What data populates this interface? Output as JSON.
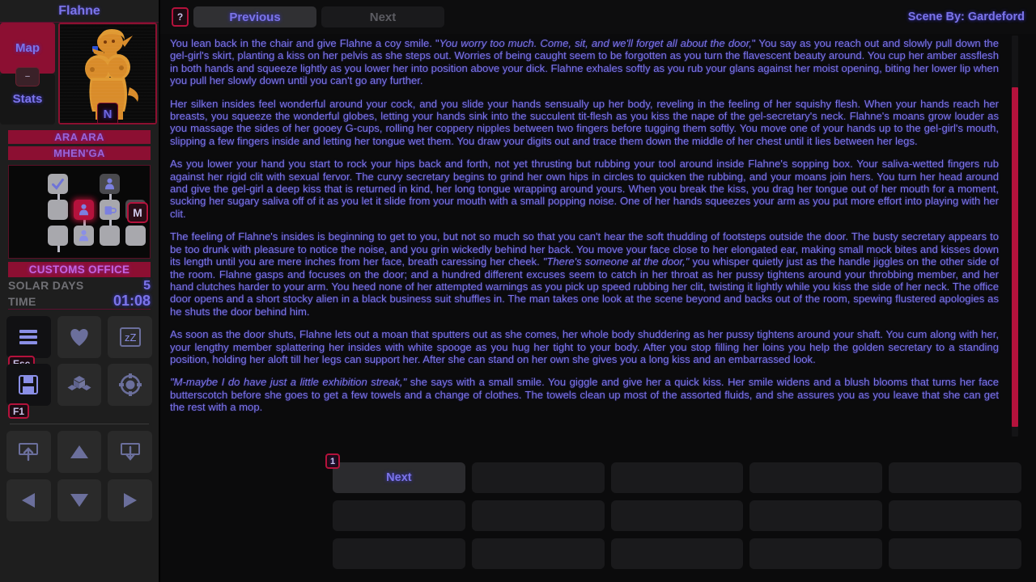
{
  "colors": {
    "accent_crimson": "#b4123c",
    "accent_purple": "#7b74e8",
    "tag_magenta": "#9a63d8",
    "panel_bg": "#1e1e1e",
    "main_bg": "#0b0b0c"
  },
  "sidebar": {
    "character_name": "Flahne",
    "map_button": "Map",
    "stats_button": "Stats",
    "panel_toggle": "–",
    "portrait_badge": "N",
    "tags": [
      "ARA ARA",
      "MHEN'GA"
    ],
    "minimap": {
      "letter_marker": "M",
      "chevron": "⌄"
    },
    "location": "CUSTOMS OFFICE",
    "stats": [
      {
        "label": "SOLAR DAYS",
        "value": "5"
      },
      {
        "label": "TIME",
        "value": "01:08"
      }
    ],
    "icon_buttons": [
      {
        "name": "menu-icon",
        "hotkey": "Esc"
      },
      {
        "name": "heart-icon",
        "hotkey": ""
      },
      {
        "name": "sleep-icon",
        "hotkey": ""
      },
      {
        "name": "save-disk-icon",
        "hotkey": "F1"
      },
      {
        "name": "inventory-cubes-icon",
        "hotkey": ""
      },
      {
        "name": "options-gear-icon",
        "hotkey": ""
      }
    ],
    "nav_buttons": [
      {
        "name": "upload-icon"
      },
      {
        "name": "arrow-up-icon"
      },
      {
        "name": "download-icon"
      },
      {
        "name": "arrow-left-icon"
      },
      {
        "name": "arrow-down-icon"
      },
      {
        "name": "arrow-right-icon"
      }
    ]
  },
  "topbar": {
    "help_label": "?",
    "previous_label": "Previous",
    "next_label": "Next",
    "scene_by": "Scene By: Gardeford"
  },
  "story": {
    "paragraphs": [
      {
        "runs": [
          {
            "t": "You lean back in the chair and give Flahne a coy smile. \"",
            "i": false
          },
          {
            "t": "You worry too much. Come, sit, and we'll forget all about the door,",
            "i": true
          },
          {
            "t": "\" You say as you reach out and slowly pull down the gel-girl's skirt, planting a kiss on her pelvis as she steps out. Worries of being caught seem to be forgotten as you turn the flavescent beauty around. You cup her amber assflesh in both hands and squeeze lightly as you lower her into position above your dick. Flahne exhales softly as you rub your glans against her moist opening, biting her lower lip when you pull her slowly down until you can't go any further.",
            "i": false
          }
        ]
      },
      {
        "runs": [
          {
            "t": "Her silken insides feel wonderful around your cock, and you slide your hands sensually up her body, reveling in the feeling of her squishy flesh. When your hands reach her breasts, you squeeze the wonderful globes, letting your hands sink into the succulent tit-flesh as you kiss the nape of the gel-secretary's neck. Flahne's moans grow louder as you massage the sides of her gooey G-cups, rolling her coppery nipples between two fingers before tugging them softly. You move one of your hands up to the gel-girl's mouth, slipping a few fingers inside and letting her tongue wet them. You draw your digits out and trace them down the middle of her chest until it lies between her legs.",
            "i": false
          }
        ]
      },
      {
        "runs": [
          {
            "t": "As you lower your hand you start to rock your hips back and forth, not yet thrusting but rubbing your tool around inside Flahne's sopping box. Your saliva-wetted fingers rub against her rigid clit with sexual fervor. The curvy secretary begins to grind her own hips in circles to quicken the rubbing, and your moans join hers. You turn her head around and give the gel-girl a deep kiss that is returned in kind, her long tongue wrapping around yours. When you break the kiss, you drag her tongue out of her mouth for a moment, sucking her sugary saliva off of it as you let it slide from your mouth with a small popping noise. One of her hands squeezes your arm as you put more effort into playing with her clit.",
            "i": false
          }
        ]
      },
      {
        "runs": [
          {
            "t": "The feeling of Flahne's insides is beginning to get to you, but not so much so that you can't hear the soft thudding of footsteps outside the door. The busty secretary appears to be too drunk with pleasure to notice the noise, and you grin wickedly behind her back. You move your face close to her elongated ear, making small mock bites and kisses down its length until you are mere inches from her face, breath caressing her cheek. ",
            "i": false
          },
          {
            "t": "\"There's someone at the door,\"",
            "i": true
          },
          {
            "t": " you whisper quietly just as the handle jiggles on the other side of the room. Flahne gasps and focuses on the door; and a hundred different excuses seem to catch in her throat as her pussy tightens around your throbbing member, and her hand clutches harder to your arm. You heed none of her attempted warnings as you pick up speed rubbing her clit, twisting it lightly while you kiss the side of her neck. The office door opens and a short stocky alien in a black business suit shuffles in. The man takes one look at the scene beyond and backs out of the room, spewing flustered apologies as he shuts the door behind him.",
            "i": false
          }
        ]
      },
      {
        "runs": [
          {
            "t": "As soon as the door shuts, Flahne lets out a moan that sputters out as she comes, her whole body shuddering as her pussy tightens around your shaft. You cum along with her, your lengthy member splattering her insides with white spooge as you hug her tight to your body. After you stop filling her loins you help the golden secretary to a standing position, holding her aloft till her legs can support her. After she can stand on her own she gives you a long kiss and an embarrassed look.",
            "i": false
          }
        ]
      },
      {
        "runs": [
          {
            "t": "\"M-maybe I do have just a little exhibition streak,\"",
            "i": true
          },
          {
            "t": " she says with a small smile. You giggle and give her a quick kiss. Her smile widens and a blush blooms that turns her face butterscotch before she goes to get a few towels and a change of clothes. The towels clean up most of the assorted fluids, and she assures you as you leave that she can get the rest with a mop.",
            "i": false
          }
        ]
      }
    ]
  },
  "choices": [
    {
      "label": "Next",
      "hotkey": "1",
      "filled": true
    },
    {
      "label": "",
      "hotkey": "",
      "filled": false
    },
    {
      "label": "",
      "hotkey": "",
      "filled": false
    },
    {
      "label": "",
      "hotkey": "",
      "filled": false
    },
    {
      "label": "",
      "hotkey": "",
      "filled": false
    },
    {
      "label": "",
      "hotkey": "",
      "filled": false
    },
    {
      "label": "",
      "hotkey": "",
      "filled": false
    },
    {
      "label": "",
      "hotkey": "",
      "filled": false
    },
    {
      "label": "",
      "hotkey": "",
      "filled": false
    },
    {
      "label": "",
      "hotkey": "",
      "filled": false
    },
    {
      "label": "",
      "hotkey": "",
      "filled": false
    },
    {
      "label": "",
      "hotkey": "",
      "filled": false
    },
    {
      "label": "",
      "hotkey": "",
      "filled": false
    },
    {
      "label": "",
      "hotkey": "",
      "filled": false
    },
    {
      "label": "",
      "hotkey": "",
      "filled": false
    }
  ]
}
